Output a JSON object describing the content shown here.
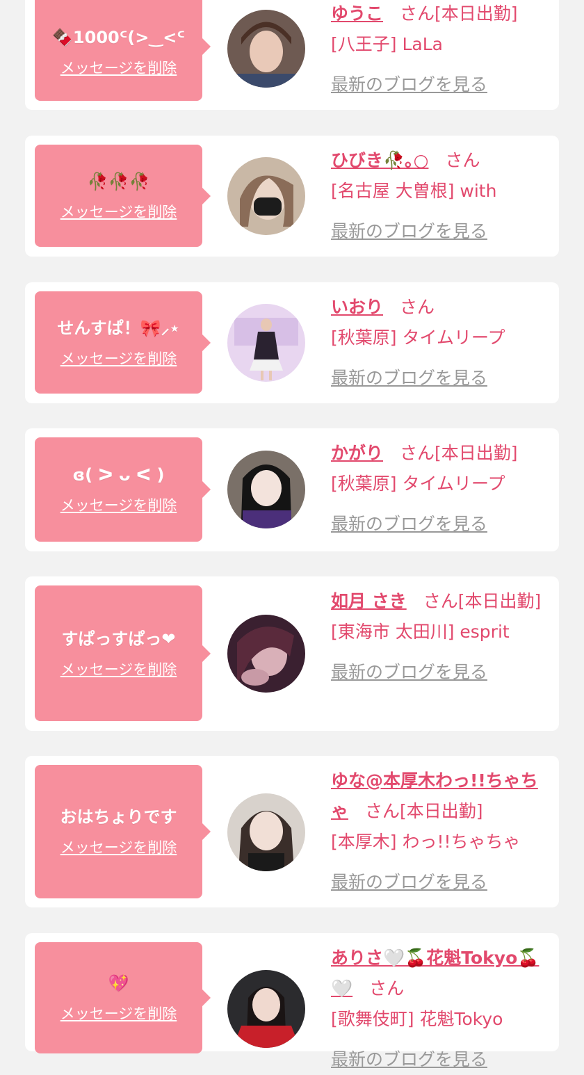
{
  "delete_label": "メッセージを削除",
  "blog_label": "最新のブログを見る",
  "accent_color": "#e2496d",
  "bubble_color": "#f78f9d",
  "entries": [
    {
      "message": "🍫1000ᑦ(>‿<ᑦ",
      "name": "ゆうこ",
      "san": "さん",
      "status": "[本日出勤]",
      "shop": "[八王子] LaLa"
    },
    {
      "message": "🥀🥀🥀",
      "name": "ひびき🥀｡○",
      "san": "さん",
      "status": "",
      "shop": "[名古屋 大曽根] with"
    },
    {
      "message": "せんすぱ！🎀⸝⋆",
      "name": "いおり",
      "san": "さん",
      "status": "",
      "shop": "[秋葉原] タイムリープ"
    },
    {
      "message": "ɞ( ᐳ ᴗ ᐸ )",
      "name": "かがり",
      "san": "さん",
      "status": "[本日出勤]",
      "shop": "[秋葉原] タイムリープ"
    },
    {
      "message": "すぱっすぱっ❤",
      "name": "如月 さき",
      "san": "さん",
      "status": "[本日出勤]",
      "shop": "[東海市 太田川] esprit"
    },
    {
      "message": "おはちょりです",
      "name": "ゆな@本厚木わっ!!ちゃちゃ",
      "san": "さん",
      "status": "[本日出勤]",
      "shop": "[本厚木] わっ!!ちゃちゃ"
    },
    {
      "message": "💖",
      "name": "ありさ🤍🍒花魁Tokyo🍒🤍",
      "san": "さん",
      "status": "",
      "shop": "[歌舞伎町] 花魁Tokyo"
    }
  ]
}
